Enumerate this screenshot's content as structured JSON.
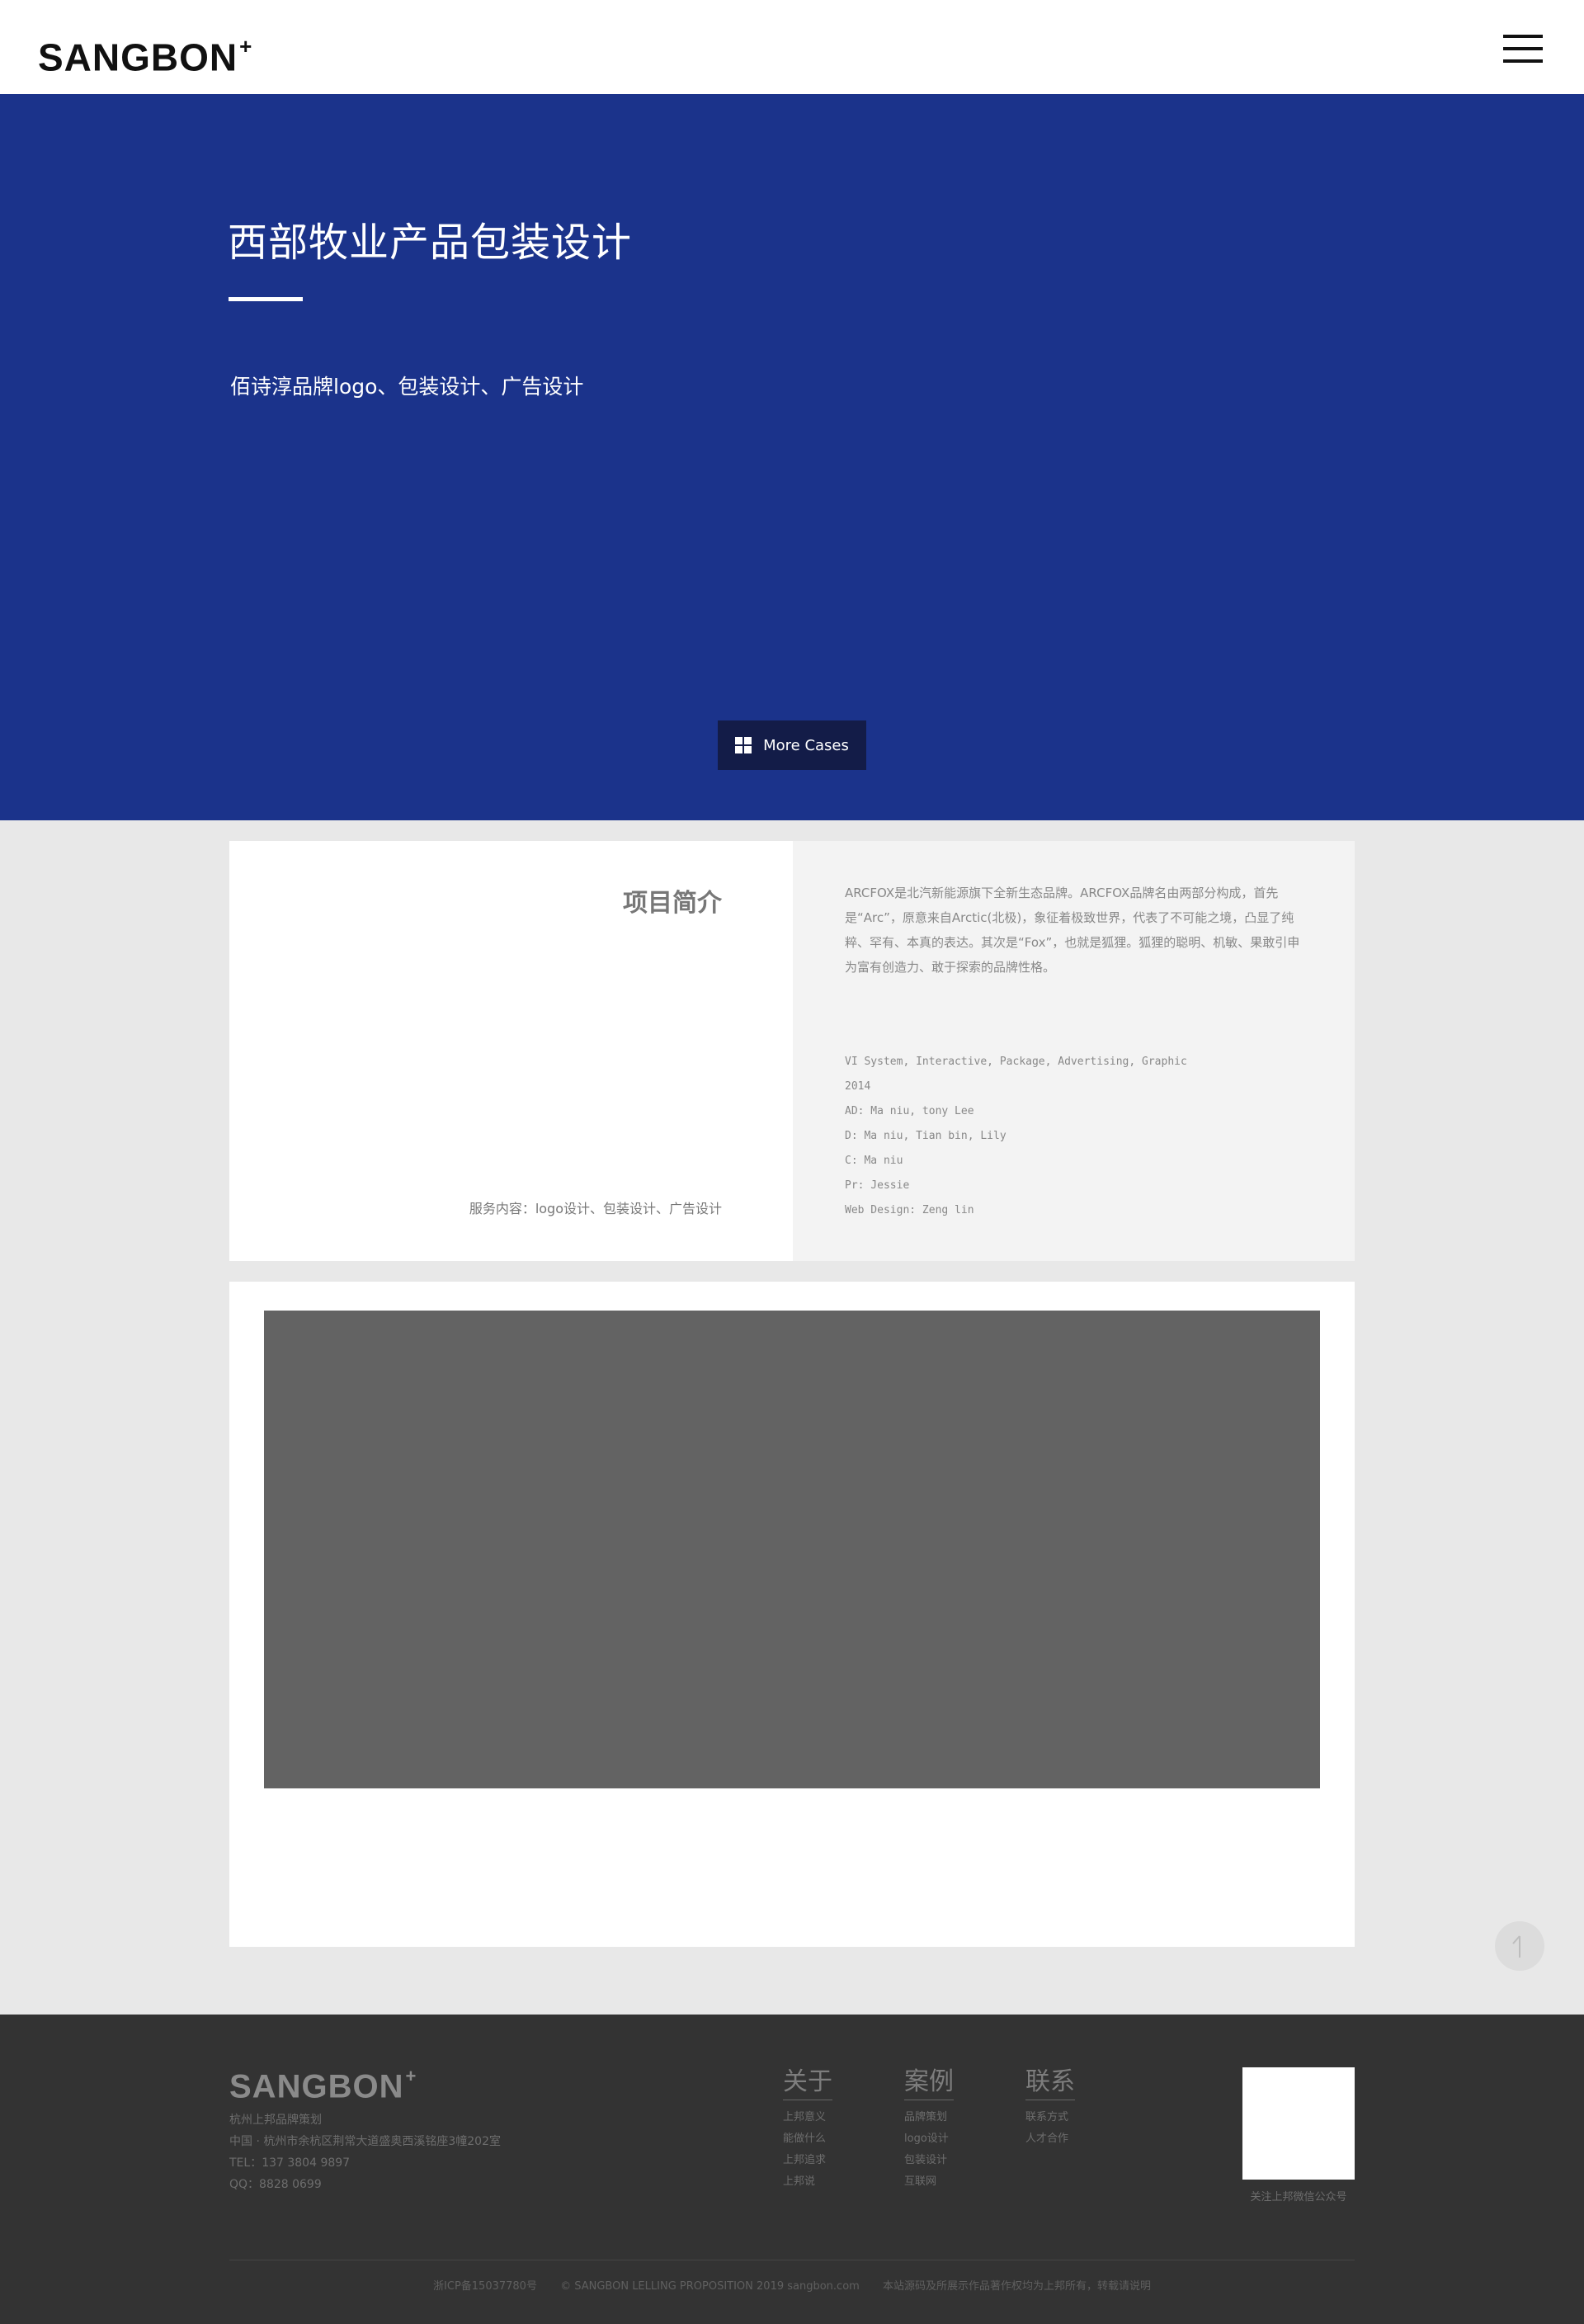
{
  "header": {
    "logo": "SANGBON",
    "logo_mark": "+",
    "menu_icon": "hamburger-menu-icon"
  },
  "hero": {
    "title": "西部牧业产品包装设计",
    "subtitle": "佰诗淳品牌logo、包装设计、广告设计",
    "more_cases_label": "More Cases",
    "more_cases_icon": "grid-icon",
    "background_color": "#1b338b"
  },
  "intro": {
    "title": "项目简介",
    "service": "服务内容：logo设计、包装设计、广告设计",
    "description": "ARCFOX是北汽新能源旗下全新生态品牌。ARCFOX品牌名由两部分构成，首先是“Arc”，原意来自Arctic(北极)，象征着极致世界，代表了不可能之境，凸显了纯粹、罕有、本真的表达。其次是“Fox”，也就是狐狸。狐狸的聪明、机敏、果敢引申为富有创造力、敢于探索的品牌性格。",
    "credits": [
      "VI System, Interactive, Package, Advertising, Graphic",
      "2014",
      "AD: Ma niu, tony Lee",
      "D: Ma niu, Tian bin, Lily",
      "C: Ma niu",
      "Pr: Jessie",
      "Web Design: Zeng lin"
    ]
  },
  "back_to_top_icon": "arrow-up-icon",
  "footer": {
    "logo": "SANGBON",
    "logo_mark": "+",
    "info": [
      "杭州上邦品牌策划",
      "中国 · 杭州市余杭区荆常大道盛奥西溪铭座3幢202室",
      "TEL：137 3804 9897",
      "QQ：8828 0699"
    ],
    "columns": [
      {
        "title": "关于",
        "links": [
          "上邦意义",
          "能做什么",
          "上邦追求",
          "上邦说"
        ]
      },
      {
        "title": "案例",
        "links": [
          "品牌策划",
          "logo设计",
          "包装设计",
          "互联网"
        ]
      },
      {
        "title": "联系",
        "links": [
          "联系方式",
          "人才合作"
        ]
      }
    ],
    "qr_caption": "关注上邦微信公众号",
    "bottom": [
      "浙ICP备15037780号",
      "© SANGBON LELLING PROPOSITION 2019 sangbon.com",
      "本站源码及所展示作品著作权均为上邦所有，转载请说明"
    ]
  }
}
